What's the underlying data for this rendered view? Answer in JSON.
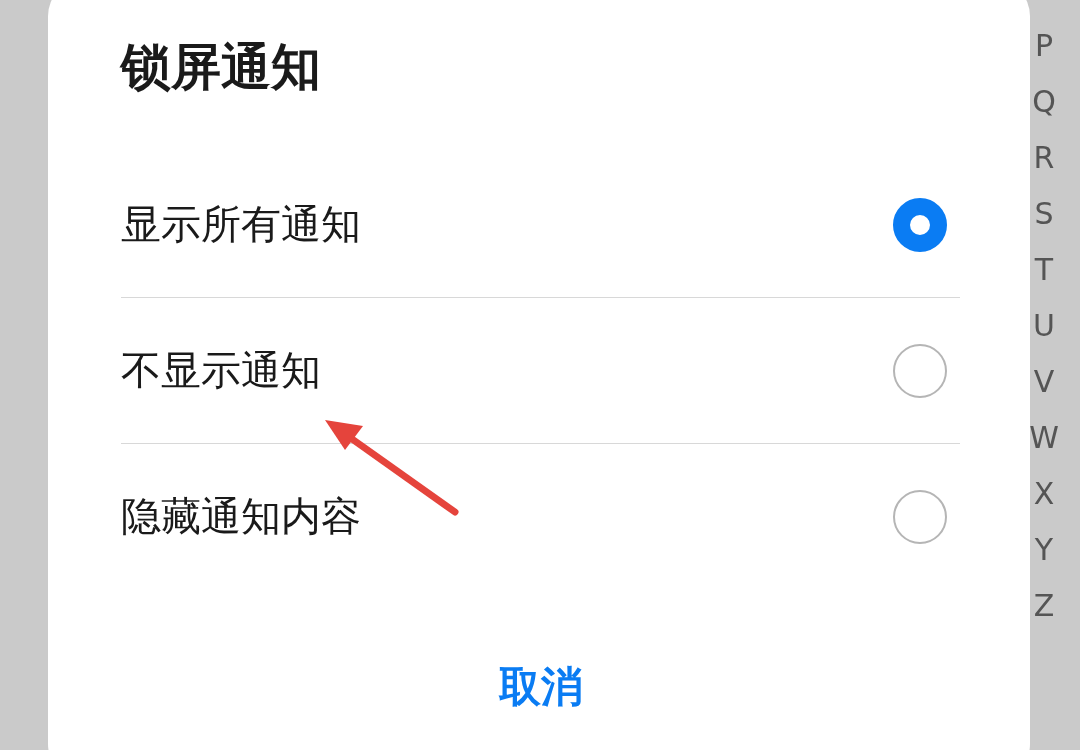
{
  "dialog": {
    "title": "锁屏通知",
    "options": [
      {
        "label": "显示所有通知",
        "selected": true
      },
      {
        "label": "不显示通知",
        "selected": false
      },
      {
        "label": "隐藏通知内容",
        "selected": false
      }
    ],
    "cancel_button": "取消"
  },
  "index_letters": [
    "P",
    "Q",
    "R",
    "S",
    "T",
    "U",
    "V",
    "W",
    "X",
    "Y",
    "Z"
  ]
}
